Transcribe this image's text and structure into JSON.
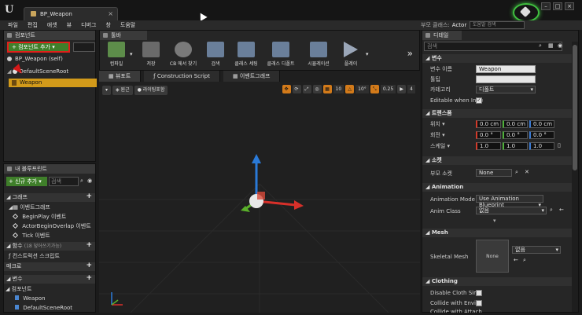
{
  "window": {
    "doc_tab": "BP_Weapon",
    "parent_class_label": "부모 클래스:",
    "parent_class_value": "Actor",
    "help_search_placeholder": "도움말 검색"
  },
  "menu": [
    "파일",
    "편집",
    "애셋",
    "뷰",
    "디버그",
    "창",
    "도움말"
  ],
  "components": {
    "tab": "컴포넌트",
    "add_button": "컴포넌트 추가",
    "self_item": "BP_Weapon (self)",
    "root_item": "DefaultSceneRoot",
    "child_item": "Weapon"
  },
  "my_blueprint": {
    "tab": "내 블루프린트",
    "new_add": "+ 신규 추가",
    "search_placeholder": "검색",
    "sections": {
      "graph": "그래프",
      "event_graph": "이벤트그래프",
      "function": "함수",
      "function_note": "(18 덮어쓰기가능)",
      "macro": "매크로",
      "variable": "변수",
      "components_sub": "컴포넌트"
    },
    "events": [
      "BeginPlay 이벤트",
      "ActorBeginOverlap 이벤트",
      "Tick 이벤트"
    ],
    "construction_script": "컨스트럭션 스크립트",
    "var_components": [
      "Weapon",
      "DefaultSceneRoot"
    ]
  },
  "toolbar": {
    "tab": "툴바",
    "tools": [
      {
        "label": "컴파일",
        "color": "#5d8d4a"
      },
      {
        "label": "저장",
        "color": "#6a6a6a"
      },
      {
        "label": "CB 에서 찾기",
        "color": "#7a7a7a"
      },
      {
        "label": "검색",
        "color": "#6a7f9a"
      },
      {
        "label": "클래스 세팅",
        "color": "#6a7f9a"
      },
      {
        "label": "클래스 디폴트",
        "color": "#6a7f9a"
      },
      {
        "label": "시뮬레이션",
        "color": "#6a7f9a"
      },
      {
        "label": "플레이",
        "color": "#6a7f9a"
      }
    ],
    "more": "»"
  },
  "viewport_tabs": [
    "뷰포트",
    "Construction Script",
    "이벤트그래프"
  ],
  "viewport": {
    "view_mode": "원근",
    "lit_mode": "라이팅포함",
    "grid_snap": "10",
    "rot_snap": "10°",
    "scale_snap": "0.25",
    "cam_speed": "4"
  },
  "details": {
    "tab": "디테일",
    "search_placeholder": "검색",
    "sections": {
      "variable": "변수",
      "transform": "트랜스폼",
      "socket": "소켓",
      "animation": "Animation",
      "mesh": "Mesh",
      "clothing": "Clothing"
    },
    "variable": {
      "name_label": "변수 이름",
      "name_value": "Weapon",
      "tooltip_label": "툴팁",
      "category_label": "카테고리",
      "category_value": "디폴트",
      "editable_label": "Editable when Inhe"
    },
    "transform": {
      "location_label": "위치",
      "location": [
        "0.0 cm",
        "0.0 cm",
        "0.0 cm"
      ],
      "rotation_label": "회전",
      "rotation": [
        "0.0 °",
        "0.0 °",
        "0.0 °"
      ],
      "scale_label": "스케일",
      "scale": [
        "1.0",
        "1.0",
        "1.0"
      ]
    },
    "socket": {
      "parent_socket_label": "부모 소켓",
      "parent_socket_value": "None"
    },
    "animation": {
      "mode_label": "Animation Mode",
      "mode_value": "Use Animation Blueprint",
      "class_label": "Anim Class",
      "class_value": "없음"
    },
    "mesh": {
      "skeletal_label": "Skeletal Mesh",
      "thumb_label": "None",
      "mesh_value": "없음"
    },
    "clothing": {
      "disable_sim": "Disable Cloth Simu",
      "collide_env": "Collide with Enviro",
      "collide_attached": "Collide with Attach"
    }
  }
}
